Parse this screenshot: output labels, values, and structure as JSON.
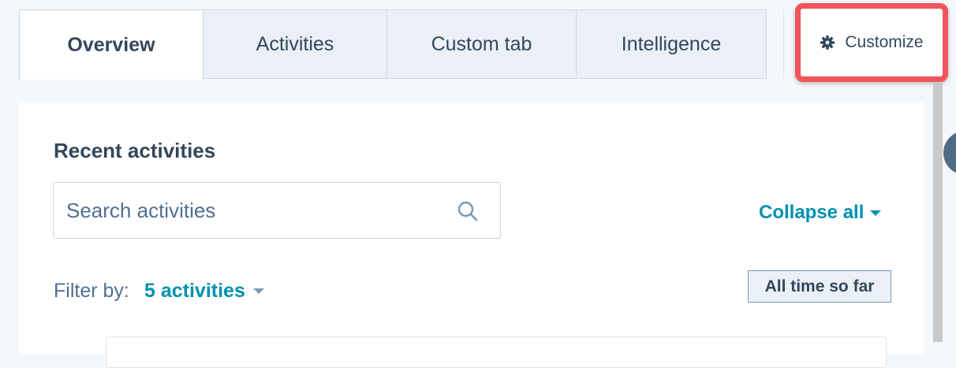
{
  "tabs": [
    {
      "label": "Overview",
      "active": true
    },
    {
      "label": "Activities",
      "active": false
    },
    {
      "label": "Custom tab",
      "active": false
    },
    {
      "label": "Intelligence",
      "active": false
    }
  ],
  "customize": {
    "label": "Customize",
    "icon": "gear-icon"
  },
  "recent_activities": {
    "title": "Recent activities",
    "search": {
      "placeholder": "Search activities",
      "value": "",
      "icon": "search-icon"
    },
    "collapse_all": "Collapse all",
    "filter": {
      "label": "Filter by:",
      "value": "5 activities"
    },
    "time_range": "All time so far"
  },
  "colors": {
    "accent": "#0091ae",
    "highlight": "#f2545b",
    "text": "#33475b",
    "background": "#f5f8fa"
  }
}
